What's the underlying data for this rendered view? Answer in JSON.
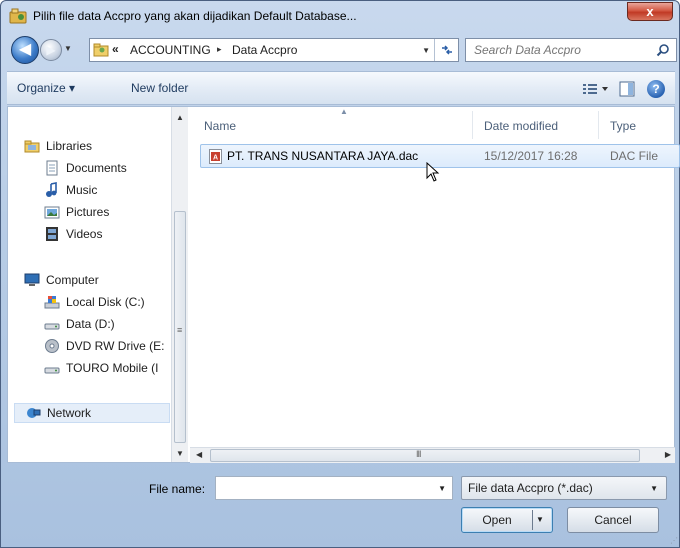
{
  "window": {
    "title": "Pilih file data Accpro yang akan dijadikan Default Database...",
    "close_label": "x"
  },
  "address": {
    "overflow_chevron": "«",
    "crumbs": [
      "ACCOUNTING",
      "Data Accpro"
    ],
    "separator": "▸"
  },
  "search": {
    "placeholder": "Search Data Accpro"
  },
  "toolbar": {
    "organize_label": "Organize ▾",
    "new_folder_label": "New folder",
    "help_label": "?"
  },
  "sidebar": {
    "items": [
      {
        "label": "Libraries",
        "icon": "libraries-icon"
      },
      {
        "label": "Documents",
        "icon": "documents-icon"
      },
      {
        "label": "Music",
        "icon": "music-icon"
      },
      {
        "label": "Pictures",
        "icon": "pictures-icon"
      },
      {
        "label": "Videos",
        "icon": "videos-icon"
      },
      {
        "label": "Computer",
        "icon": "computer-icon"
      },
      {
        "label": "Local Disk (C:)",
        "icon": "local-disk-icon"
      },
      {
        "label": "Data (D:)",
        "icon": "drive-icon"
      },
      {
        "label": "DVD RW Drive (E:",
        "icon": "dvd-icon"
      },
      {
        "label": "TOURO Mobile (I",
        "icon": "drive-icon"
      },
      {
        "label": "Network",
        "icon": "network-icon"
      }
    ],
    "selected_index": 10
  },
  "file_list": {
    "columns": [
      "Name",
      "Date modified",
      "Type"
    ],
    "rows": [
      {
        "name": "PT. TRANS NUSANTARA JAYA.dac",
        "date_modified": "15/12/2017 16:28",
        "type": "DAC File"
      }
    ]
  },
  "scroll": {
    "h_grip": "III",
    "v_grip": "≡"
  },
  "footer": {
    "file_name_label": "File name:",
    "file_name_value": "",
    "filter_value": "File data Accpro (*.dac)",
    "open_label": "Open",
    "cancel_label": "Cancel"
  },
  "colors": {
    "titlebar": "#b8cde6",
    "close": "#c03a25",
    "selection": "#dcebfc"
  }
}
